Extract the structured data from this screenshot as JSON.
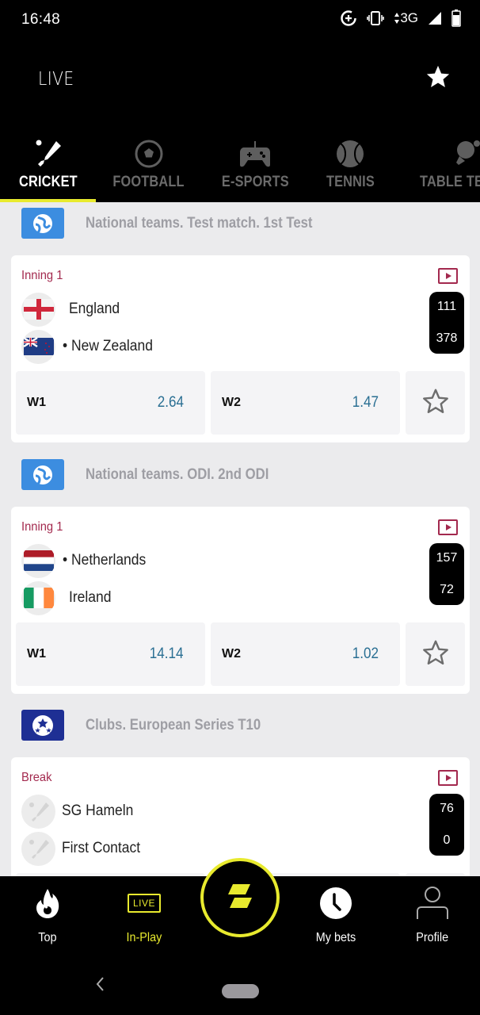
{
  "status_bar": {
    "time": "16:48",
    "network": "3G",
    "icons": [
      "data-saver-icon",
      "vibrate-icon",
      "signal-icon",
      "battery-icon"
    ]
  },
  "header": {
    "title": "LIVE",
    "favorites_icon": "star-icon"
  },
  "sport_tabs": [
    {
      "label": "CRICKET",
      "icon": "cricket-icon",
      "active": true
    },
    {
      "label": "FOOTBALL",
      "icon": "football-icon",
      "active": false
    },
    {
      "label": "E-SPORTS",
      "icon": "gamepad-icon",
      "active": false
    },
    {
      "label": "TENNIS",
      "icon": "tennis-ball-icon",
      "active": false
    },
    {
      "label": "TABLE TENNIS",
      "icon": "table-tennis-icon",
      "active": false
    }
  ],
  "leagues": [
    {
      "name": "National teams. Test match. 1st Test",
      "logo": "globe-icon",
      "logo_color": "#3c8de0",
      "match": {
        "status": "Inning 1",
        "team1": {
          "name": "England",
          "flag": "england-flag",
          "serving": false
        },
        "team2": {
          "name": "New Zealand",
          "flag": "new-zealand-flag",
          "serving": true
        },
        "score1": "111",
        "score2": "378",
        "odds": [
          {
            "label": "W1",
            "value": "2.64"
          },
          {
            "label": "W2",
            "value": "1.47"
          }
        ]
      }
    },
    {
      "name": "National teams. ODI. 2nd ODI",
      "logo": "globe-icon",
      "logo_color": "#3c8de0",
      "match": {
        "status": "Inning 1",
        "team1": {
          "name": "Netherlands",
          "flag": "netherlands-flag",
          "serving": true
        },
        "team2": {
          "name": "Ireland",
          "flag": "ireland-flag",
          "serving": false
        },
        "score1": "157",
        "score2": "72",
        "odds": [
          {
            "label": "W1",
            "value": "14.14"
          },
          {
            "label": "W2",
            "value": "1.02"
          }
        ]
      }
    },
    {
      "name": "Clubs. European Series T10",
      "logo": "champions-ball-icon",
      "logo_color": "#1e2f94",
      "match": {
        "status": "Break",
        "team1": {
          "name": "SG Hameln",
          "flag": "cricket-placeholder-icon",
          "serving": false
        },
        "team2": {
          "name": "First Contact",
          "flag": "cricket-placeholder-icon",
          "serving": false
        },
        "score1": "76",
        "score2": "0"
      }
    }
  ],
  "bottom_nav": [
    {
      "label": "Top",
      "icon": "flame-icon",
      "active": false
    },
    {
      "label": "In-Play",
      "icon": "live-icon",
      "icon_text": "LIVE",
      "active": true
    },
    {
      "label": "",
      "icon": "brand-logo-icon",
      "active": false
    },
    {
      "label": "My bets",
      "icon": "clock-icon",
      "active": false
    },
    {
      "label": "Profile",
      "icon": "person-icon",
      "active": false
    }
  ],
  "colors": {
    "accent": "#e8ea2e",
    "status_text": "#a3294e",
    "odd_value": "#2a6f93",
    "background": "#ebebed"
  }
}
